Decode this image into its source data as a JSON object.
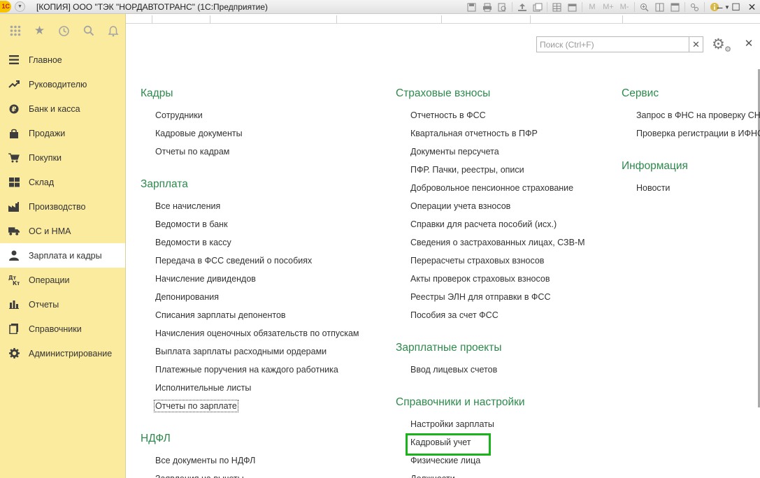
{
  "window": {
    "title": "[КОПИЯ] ООО \"ТЭК \"НОРДАВТОТРАНС\" (1С:Предприятие)",
    "logo_text": "1С",
    "memory_buttons": [
      "M",
      "M+",
      "M-"
    ]
  },
  "sidebar": {
    "items": [
      {
        "label": "Главное",
        "icon": "menu-lines-icon"
      },
      {
        "label": "Руководителю",
        "icon": "trend-icon"
      },
      {
        "label": "Банк и касса",
        "icon": "coin-icon"
      },
      {
        "label": "Продажи",
        "icon": "bag-icon"
      },
      {
        "label": "Покупки",
        "icon": "cart-icon"
      },
      {
        "label": "Склад",
        "icon": "warehouse-icon"
      },
      {
        "label": "Производство",
        "icon": "factory-icon"
      },
      {
        "label": "ОС и НМА",
        "icon": "truck-icon"
      },
      {
        "label": "Зарплата и кадры",
        "icon": "person-icon",
        "active": true
      },
      {
        "label": "Операции",
        "icon": "debit-credit-icon"
      },
      {
        "label": "Отчеты",
        "icon": "bar-chart-icon"
      },
      {
        "label": "Справочники",
        "icon": "book-icon"
      },
      {
        "label": "Администрирование",
        "icon": "gear-icon"
      }
    ]
  },
  "search": {
    "placeholder": "Поиск (Ctrl+F)",
    "value": ""
  },
  "sections": {
    "kadry": {
      "title": "Кадры",
      "links": [
        "Сотрудники",
        "Кадровые документы",
        "Отчеты по кадрам"
      ]
    },
    "zarplata": {
      "title": "Зарплата",
      "links": [
        "Все начисления",
        "Ведомости в банк",
        "Ведомости в кассу",
        "Передача в ФСС сведений о пособиях",
        "Начисление дивидендов",
        "Депонирования",
        "Списания зарплаты депонентов",
        "Начисления оценочных обязательств по отпускам",
        "Выплата зарплаты расходными ордерами",
        "Платежные поручения на каждого работника",
        "Исполнительные листы",
        "Отчеты по зарплате"
      ]
    },
    "ndfl": {
      "title": "НДФЛ",
      "links": [
        "Все документы по НДФЛ",
        "Заявления на вычеты"
      ]
    },
    "strakh": {
      "title": "Страховые взносы",
      "links": [
        "Отчетность в ФСС",
        "Квартальная отчетность в ПФР",
        "Документы персучета",
        "ПФР. Пачки, реестры, описи",
        "Добровольное пенсионное страхование",
        "Операции учета взносов",
        "Справки для расчета пособий (исх.)",
        "Сведения о застрахованных лицах, СЗВ-М",
        "Перерасчеты страховых взносов",
        "Акты проверок страховых взносов",
        "Реестры ЭЛН для отправки в ФСС",
        "Пособия за счет ФСС"
      ]
    },
    "proekty": {
      "title": "Зарплатные проекты",
      "links": [
        "Ввод лицевых счетов"
      ]
    },
    "spravochniki": {
      "title": "Справочники и настройки",
      "links": [
        "Настройки зарплаты",
        "Кадровый учет",
        "Физические лица",
        "Должности"
      ]
    },
    "servis": {
      "title": "Сервис",
      "links": [
        "Запрос в ФНС на проверку СНИЛС",
        "Проверка регистрации в ИФНС"
      ]
    },
    "info": {
      "title": "Информация",
      "links": [
        "Новости"
      ]
    }
  }
}
